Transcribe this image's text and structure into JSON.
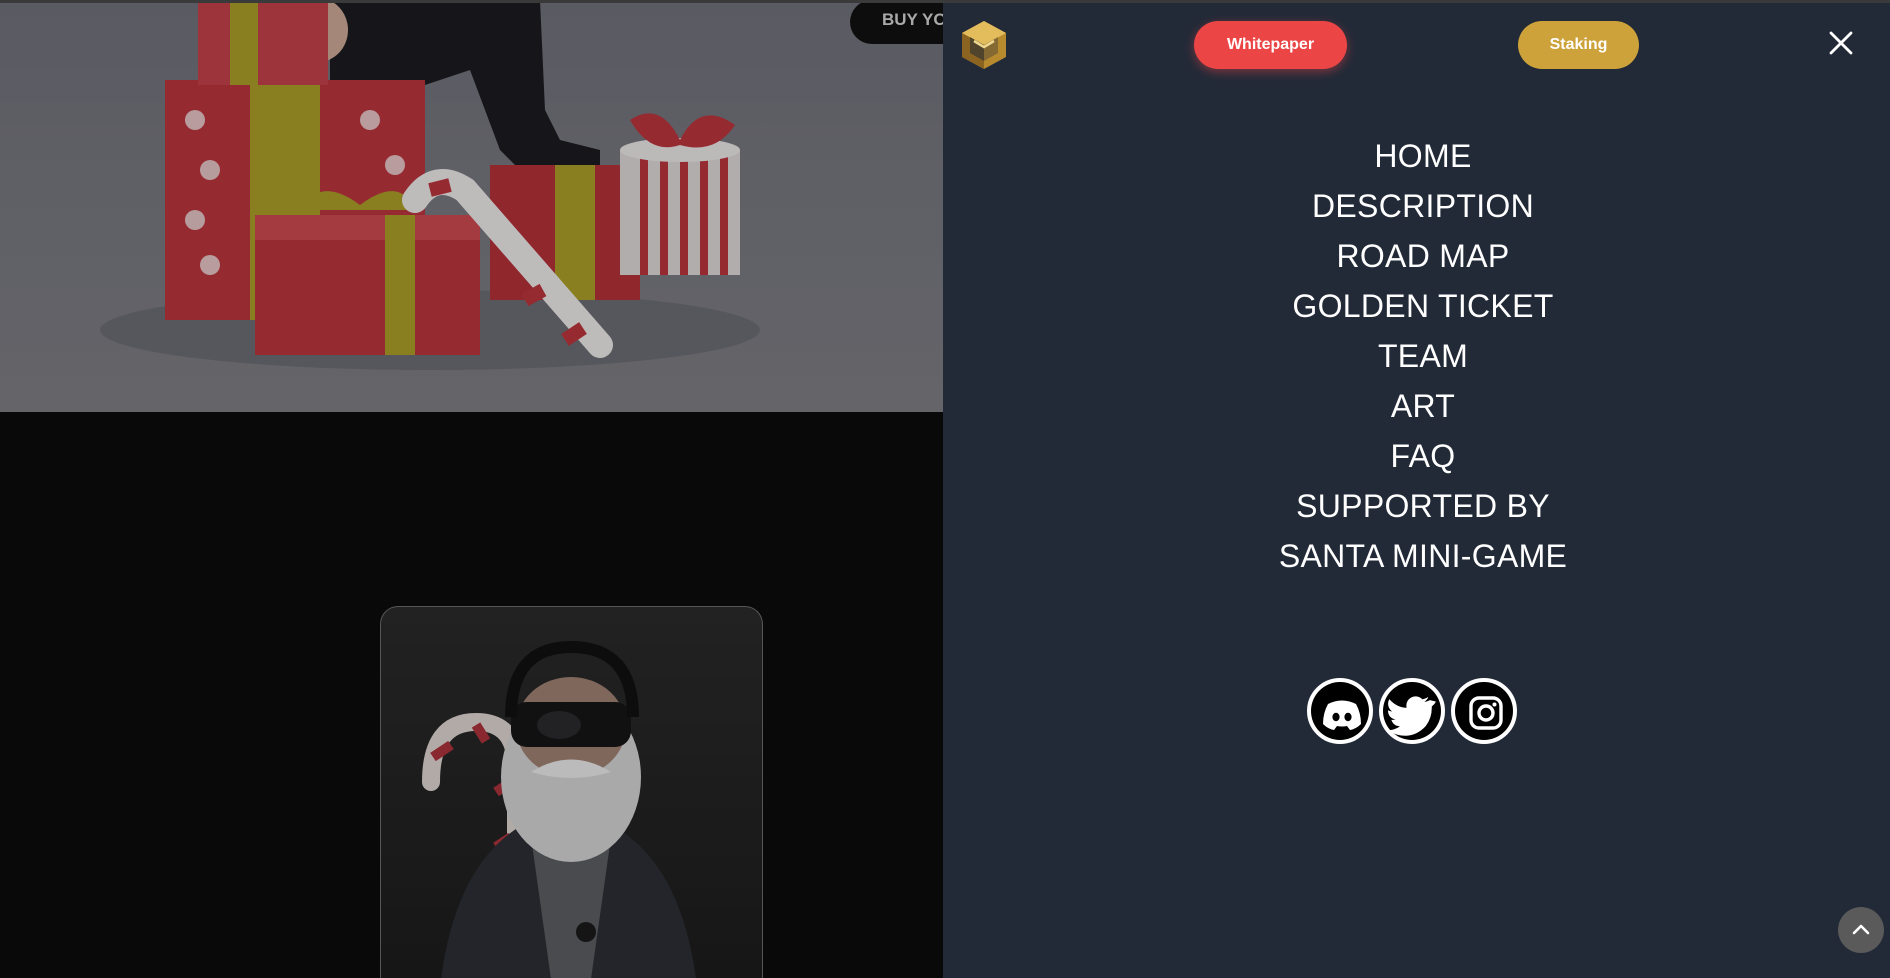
{
  "background": {
    "buy_button_label": "BUY YO",
    "hero_image": "santa-on-gift-boxes-image",
    "nft_card_image": "santa-vr-headset-nft-image"
  },
  "menu": {
    "logo": "cube-logo-icon",
    "whitepaper_label": "Whitepaper",
    "staking_label": "Staking",
    "close_icon": "close-icon",
    "nav_items": [
      "HOME",
      "DESCRIPTION",
      "ROAD MAP",
      "GOLDEN TICKET",
      "TEAM",
      "ART",
      "FAQ",
      "SUPPORTED BY",
      "SANTA MINI-GAME"
    ],
    "socials": [
      "discord-icon",
      "twitter-icon",
      "instagram-icon"
    ]
  },
  "scroll_top_icon": "chevron-up-icon",
  "colors": {
    "panel_bg": "#222a38",
    "whitepaper_btn": "#ec4545",
    "staking_btn": "#cda23a",
    "nav_text": "#ffffff",
    "page_bg": "#0b0b0b"
  }
}
